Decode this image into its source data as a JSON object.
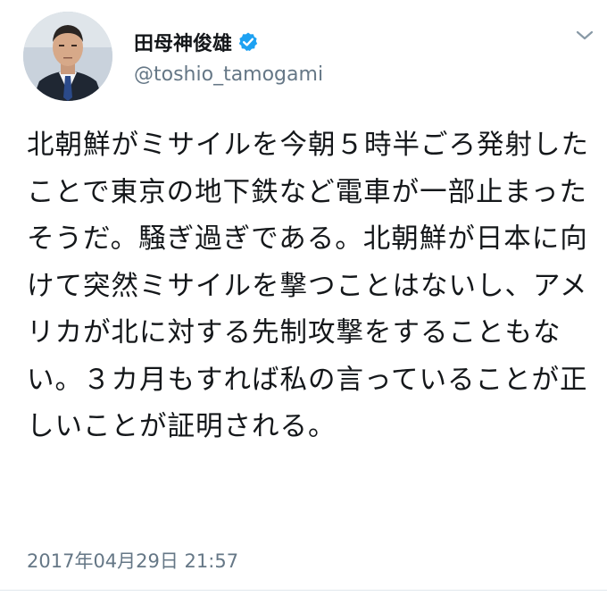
{
  "tweet": {
    "author": {
      "display_name": "田母神俊雄",
      "handle": "@toshio_tamogami",
      "verified": true,
      "avatar_icon": "profile-photo"
    },
    "text": "北朝鮮がミサイルを今朝５時半ごろ発射したことで東京の地下鉄など電車が一部止まったそうだ。騒ぎ過ぎである。北朝鮮が日本に向けて突然ミサイルを撃つことはないし、アメリカが北に対する先制攻撃をすることもない。３カ月もすれば私の言っていることが正しいことが証明される。",
    "timestamp": "2017年04月29日 21:57",
    "menu_icon": "chevron-down-icon"
  },
  "colors": {
    "text": "#14171a",
    "secondary_text": "#657786",
    "verified_badge": "#1da1f2",
    "divider": "#e1e8ed"
  }
}
